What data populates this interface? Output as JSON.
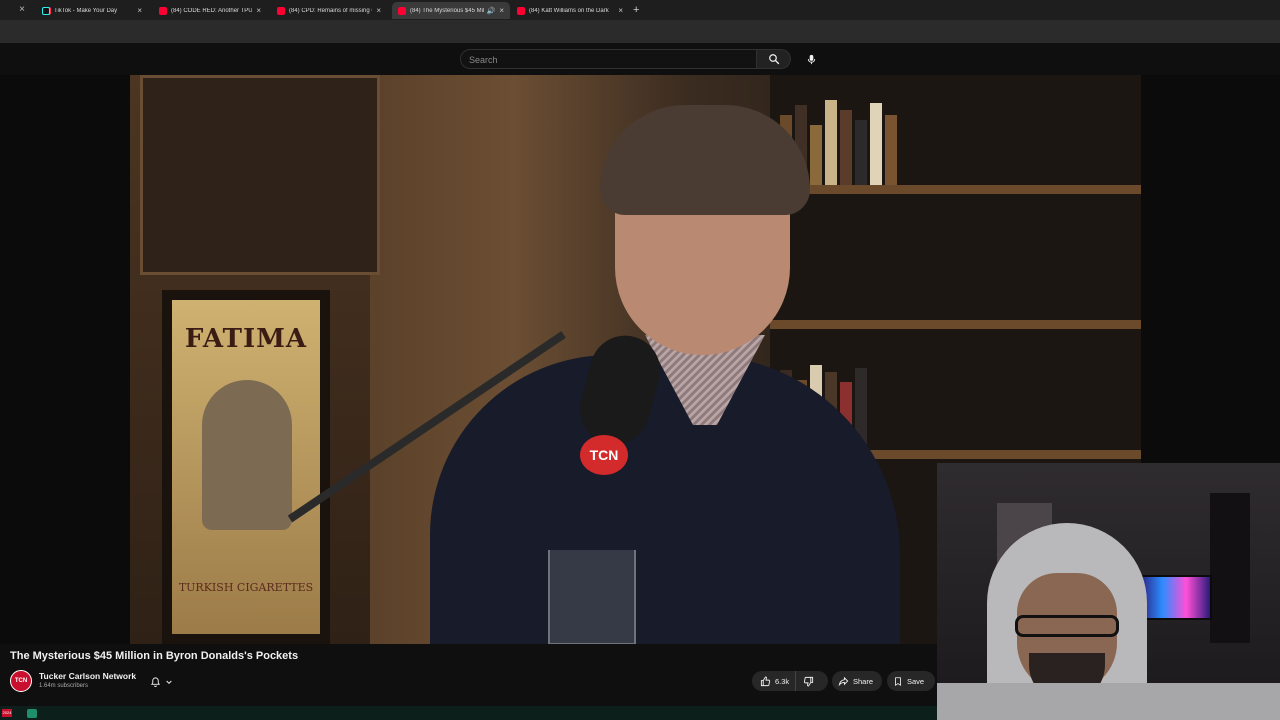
{
  "browser": {
    "tabs": [
      {
        "title": "TikTok - Make Your Day",
        "favicon": "tiktok-icon",
        "active": false
      },
      {
        "title": "(84) CODE RED: Another TPUSA",
        "favicon": "youtube-icon",
        "active": false
      },
      {
        "title": "(84) CPD: Remains of missing C",
        "favicon": "youtube-icon",
        "active": false
      },
      {
        "title": "(84) The Mysterious $45 Mil",
        "favicon": "youtube-icon",
        "active": true,
        "audio": true
      },
      {
        "title": "(84) Katt Williams on the Dark",
        "favicon": "youtube-icon",
        "active": false
      }
    ],
    "close_glyph": "×",
    "new_tab_glyph": "+"
  },
  "masthead": {
    "search_placeholder": "Search",
    "search_icon": "search-icon",
    "mic_icon": "mic-icon"
  },
  "video": {
    "title": "The Mysterious $45 Million in Byron Donalds's Pockets",
    "channel": "Tucker Carlson Network",
    "channel_avatar": "TCN",
    "subscribers": "1.64m subscribers",
    "mic_badge": "TCN",
    "poster_text": "FATIMA",
    "poster_subtext": "TURKISH CIGARETTES"
  },
  "actions": {
    "likes": "6.3k",
    "share_label": "Share",
    "save_label": "Save"
  },
  "bottom_strip": {
    "badge": "2024"
  },
  "colors": {
    "background": "#0f0f0f",
    "tab_active": "#3a3a3a",
    "youtube_red": "#ff0033",
    "button_bg": "#272727"
  }
}
